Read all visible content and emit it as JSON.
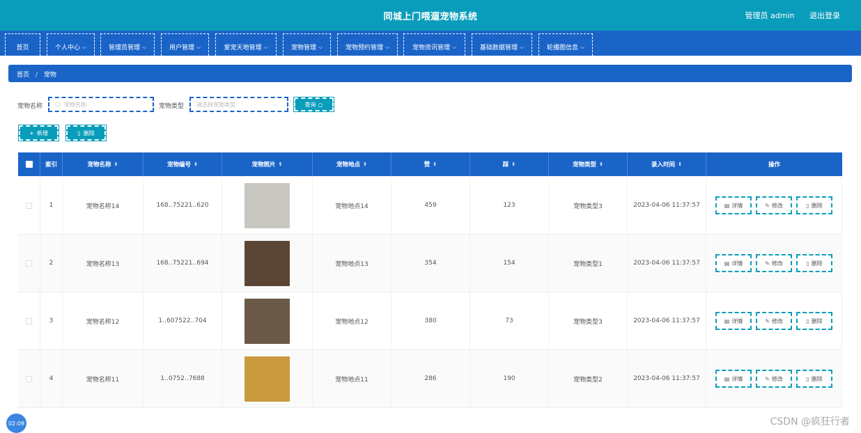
{
  "header": {
    "title": "同城上门喂遛宠物系统",
    "user": "管理员 admin",
    "logout": "退出登录"
  },
  "nav": {
    "items": [
      {
        "label": "首页",
        "chev": ""
      },
      {
        "label": "个人中心",
        "chev": "⌵"
      },
      {
        "label": "管理员管理",
        "chev": "⌵"
      },
      {
        "label": "用户管理",
        "chev": "⌵"
      },
      {
        "label": "爱宠天地管理",
        "chev": "⌵"
      },
      {
        "label": "宠物管理",
        "chev": "⌵"
      },
      {
        "label": "宠物预约管理",
        "chev": "⌵"
      },
      {
        "label": "宠物资讯管理",
        "chev": "⌵"
      },
      {
        "label": "基础数据管理",
        "chev": "⌵"
      },
      {
        "label": "轮播图信息",
        "chev": "⌵"
      }
    ]
  },
  "breadcrumb": {
    "home": "首页",
    "sep": "/",
    "current": "宠物"
  },
  "search": {
    "name_label": "宠物名称",
    "name_placeholder": "宠物名称",
    "type_label": "宠物类型",
    "type_placeholder": "请选择宠物类型",
    "query_label": "查询"
  },
  "actions": {
    "add_label": "新增",
    "delete_label": "删除"
  },
  "table": {
    "headers": [
      "索引",
      "宠物名称",
      "宠物编号",
      "宠物照片",
      "宠物地点",
      "赞",
      "踩",
      "宠物类型",
      "录入时间",
      "操作"
    ],
    "rows": [
      {
        "index": "1",
        "name": "宠物名称14",
        "code": "168‥75221‥620",
        "place": "宠物地点14",
        "likes": "459",
        "dislikes": "123",
        "type": "宠物类型3",
        "time": "2023-04-06 11:37:57",
        "photo": "#c9c7c2"
      },
      {
        "index": "2",
        "name": "宠物名称13",
        "code": "168‥75221‥694",
        "place": "宠物地点13",
        "likes": "354",
        "dislikes": "154",
        "type": "宠物类型1",
        "time": "2023-04-06 11:37:57",
        "photo": "#5b4636"
      },
      {
        "index": "3",
        "name": "宠物名称12",
        "code": "1‥607522‥704",
        "place": "宠物地点12",
        "likes": "380",
        "dislikes": "73",
        "type": "宠物类型3",
        "time": "2023-04-06 11:37:57",
        "photo": "#6b5a48"
      },
      {
        "index": "4",
        "name": "宠物名称11",
        "code": "1‥0752‥7688",
        "place": "宠物地点11",
        "likes": "286",
        "dislikes": "190",
        "type": "宠物类型2",
        "time": "2023-04-06 11:37:57",
        "photo": "#c99a3e"
      }
    ],
    "ops": {
      "detail": "详情",
      "edit": "修改",
      "delete": "删除"
    }
  },
  "timer": "02:09",
  "watermark": "CSDN @疯狂行者"
}
